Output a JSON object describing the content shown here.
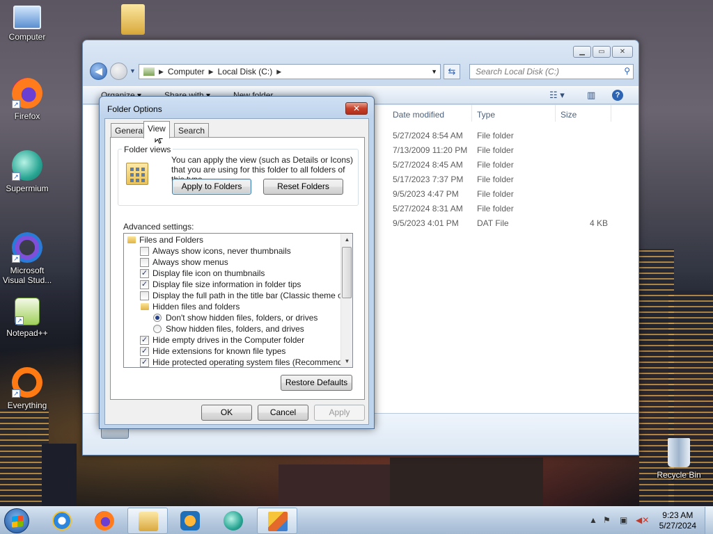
{
  "desktop": {
    "icons": [
      {
        "label": "Computer",
        "icon": "computer-icon"
      },
      {
        "label": "",
        "icon": "folder-icon"
      },
      {
        "label": "Firefox",
        "icon": "firefox-icon"
      },
      {
        "label": "Supermium",
        "icon": "supermium-icon"
      },
      {
        "label": "Microsoft Visual Stud...",
        "icon": "visual-studio-icon"
      },
      {
        "label": "Notepad++",
        "icon": "notepadpp-icon"
      },
      {
        "label": "Everything",
        "icon": "everything-icon"
      },
      {
        "label": "Recycle Bin",
        "icon": "recycle-bin-icon"
      }
    ]
  },
  "explorer": {
    "address": {
      "root": "Computer",
      "path": "Local Disk (C:)"
    },
    "search_placeholder": "Search Local Disk (C:)",
    "toolbar": {
      "organize": "Organize",
      "share_with": "Share with",
      "new_folder": "New folder"
    },
    "columns": {
      "date_modified": "Date modified",
      "type": "Type",
      "size": "Size"
    },
    "rows": [
      {
        "date": "5/27/2024 8:54 AM",
        "type": "File folder",
        "size": ""
      },
      {
        "date": "7/13/2009 11:20 PM",
        "type": "File folder",
        "size": ""
      },
      {
        "date": "5/27/2024 8:45 AM",
        "type": "File folder",
        "size": ""
      },
      {
        "date": "5/17/2023 7:37 PM",
        "type": "File folder",
        "size": ""
      },
      {
        "date": "9/5/2023 4:47 PM",
        "type": "File folder",
        "size": ""
      },
      {
        "date": "5/27/2024 8:31 AM",
        "type": "File folder",
        "size": ""
      },
      {
        "date": "9/5/2023 4:01 PM",
        "type": "DAT File",
        "size": "4 KB"
      }
    ]
  },
  "dialog": {
    "title": "Folder Options",
    "close": "✕",
    "tabs": [
      {
        "label": "General"
      },
      {
        "label": "View"
      },
      {
        "label": "Search"
      }
    ],
    "active_tab": "View",
    "folder_views": {
      "legend": "Folder views",
      "text": "You can apply the view (such as Details or Icons) that you are using for this folder to all folders of this type.",
      "apply_button": "Apply to Folders",
      "reset_button": "Reset Folders"
    },
    "advanced_label": "Advanced settings:",
    "advanced_items": [
      {
        "kind": "folder",
        "label": "Files and Folders"
      },
      {
        "kind": "checkbox",
        "label": "Always show icons, never thumbnails",
        "checked": false
      },
      {
        "kind": "checkbox",
        "label": "Always show menus",
        "checked": false
      },
      {
        "kind": "checkbox",
        "label": "Display file icon on thumbnails",
        "checked": true
      },
      {
        "kind": "checkbox",
        "label": "Display file size information in folder tips",
        "checked": true
      },
      {
        "kind": "checkbox",
        "label": "Display the full path in the title bar (Classic theme only)",
        "checked": false
      },
      {
        "kind": "folder-sub",
        "label": "Hidden files and folders"
      },
      {
        "kind": "radio",
        "label": "Don't show hidden files, folders, or drives",
        "checked": true
      },
      {
        "kind": "radio",
        "label": "Show hidden files, folders, and drives",
        "checked": false
      },
      {
        "kind": "checkbox",
        "label": "Hide empty drives in the Computer folder",
        "checked": true
      },
      {
        "kind": "checkbox",
        "label": "Hide extensions for known file types",
        "checked": true
      },
      {
        "kind": "checkbox",
        "label": "Hide protected operating system files (Recommended)",
        "checked": true
      }
    ],
    "restore_defaults": "Restore Defaults",
    "ok": "OK",
    "cancel": "Cancel",
    "apply": "Apply"
  },
  "taskbar": {
    "apps": [
      {
        "name": "internet-explorer",
        "active": false
      },
      {
        "name": "firefox",
        "active": false
      },
      {
        "name": "file-explorer",
        "active": true
      },
      {
        "name": "media-player",
        "active": false
      },
      {
        "name": "supermium",
        "active": false
      },
      {
        "name": "folder-options",
        "active": true
      }
    ],
    "clock": {
      "time": "9:23 AM",
      "date": "5/27/2024"
    }
  },
  "colors": {
    "accent": "#2e64b4",
    "dialog_close": "#c6402a"
  }
}
